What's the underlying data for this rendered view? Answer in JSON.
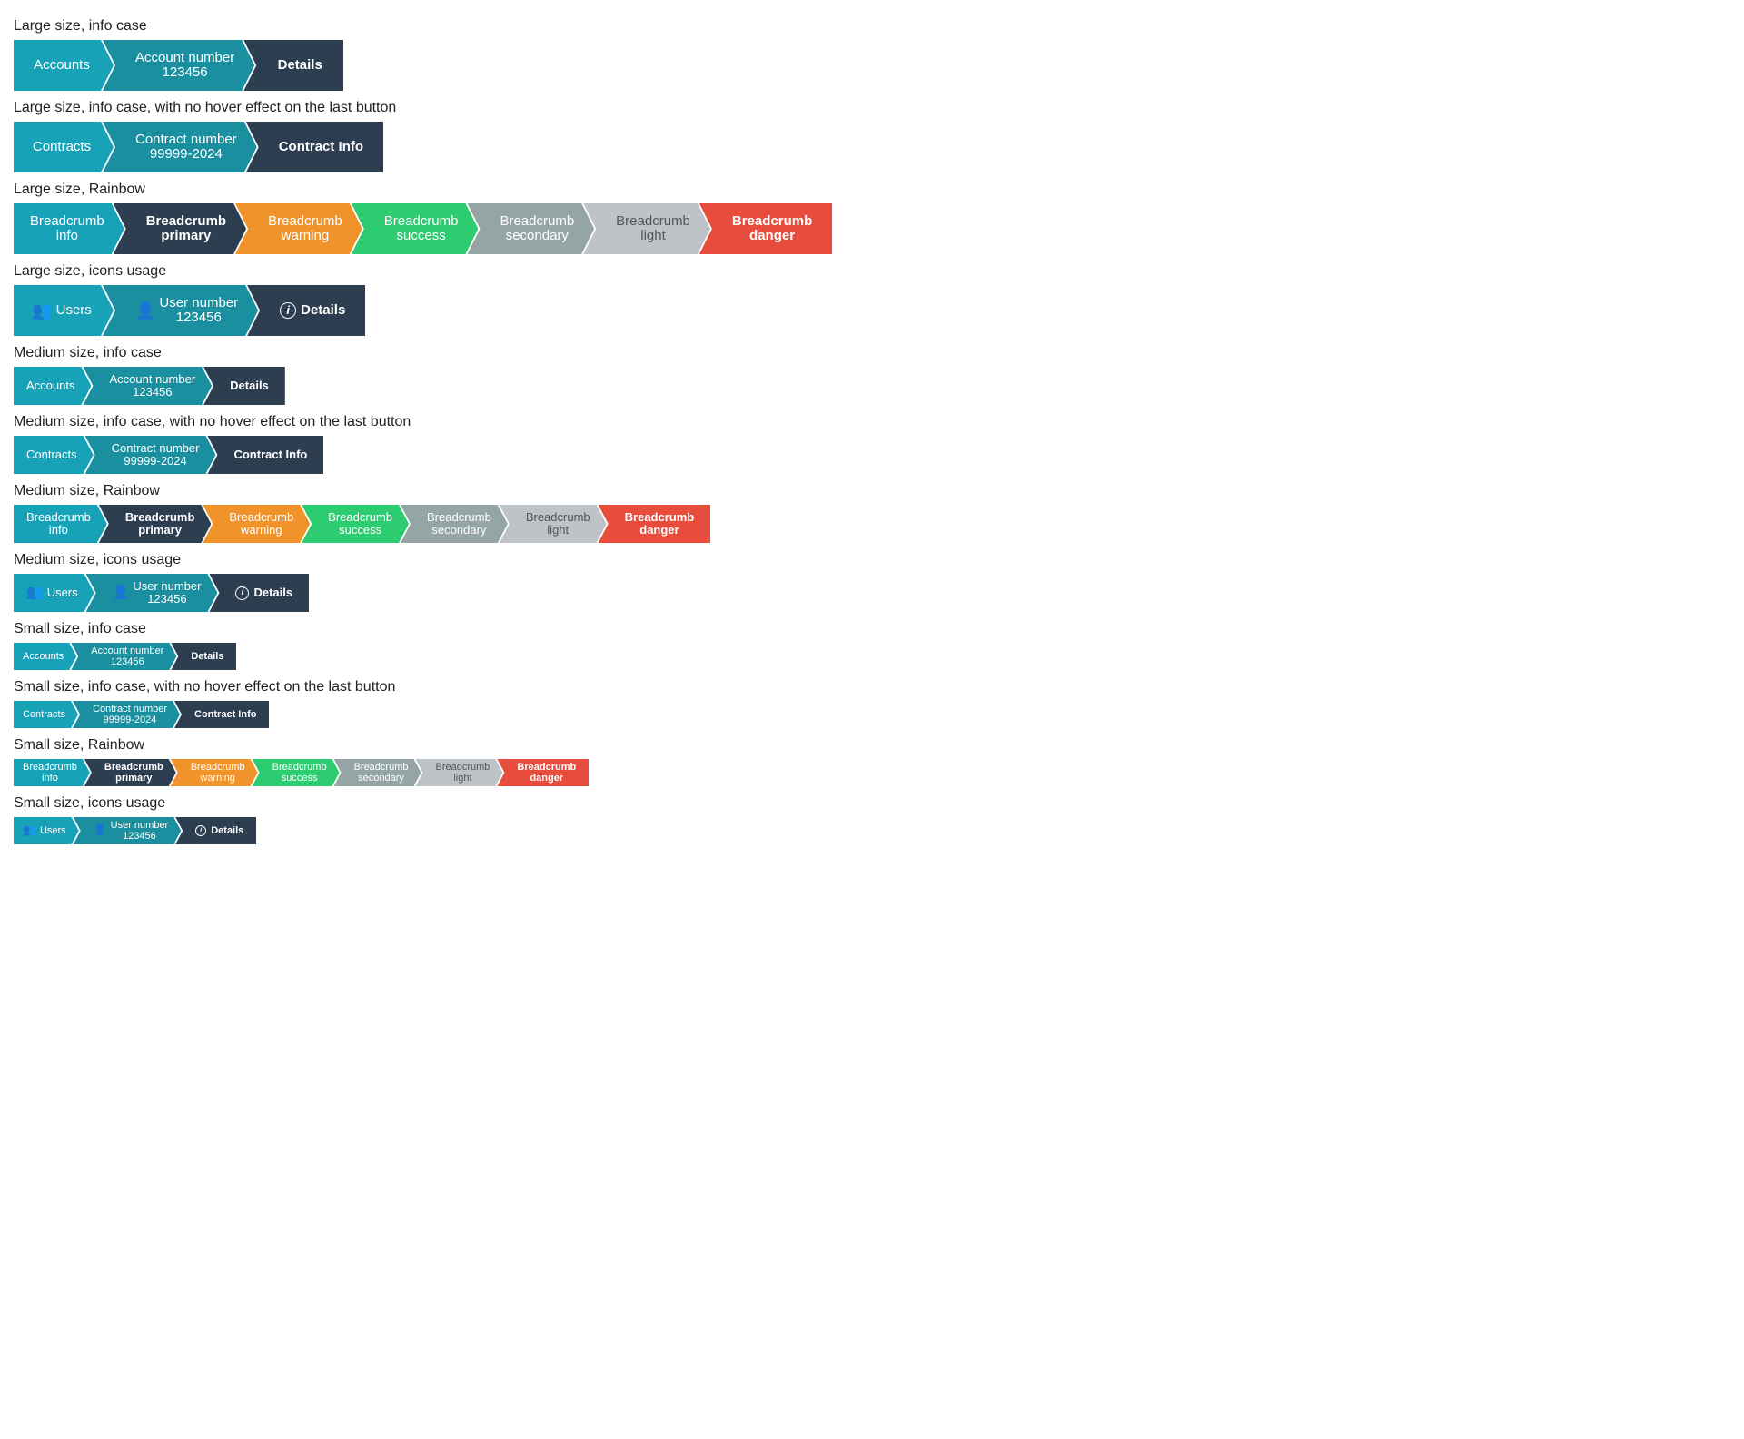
{
  "sections": [
    {
      "id": "large-info",
      "label": "Large size, info case",
      "trails": [
        {
          "id": "trail-large-info-1",
          "size": "lg",
          "crumbs": [
            {
              "id": "c1",
              "text": "Accounts",
              "color": "info",
              "position": "first",
              "bold": false,
              "icon": null
            },
            {
              "id": "c2",
              "text1": "Account number",
              "text2": "123456",
              "color": "teal",
              "position": "middle",
              "bold": false,
              "icon": null
            },
            {
              "id": "c3",
              "text": "Details",
              "color": "primary",
              "position": "last",
              "bold": true,
              "icon": null
            }
          ]
        }
      ]
    },
    {
      "id": "large-info-no-hover",
      "label": "Large size, info case, with no hover effect on the last button",
      "trails": [
        {
          "id": "trail-large-info-2",
          "size": "lg",
          "crumbs": [
            {
              "id": "c1",
              "text": "Contracts",
              "color": "info",
              "position": "first",
              "bold": false,
              "icon": null
            },
            {
              "id": "c2",
              "text1": "Contract number",
              "text2": "99999-2024",
              "color": "teal",
              "position": "middle",
              "bold": false,
              "icon": null
            },
            {
              "id": "c3",
              "text": "Contract Info",
              "color": "primary",
              "position": "last",
              "bold": true,
              "icon": null
            }
          ]
        }
      ]
    },
    {
      "id": "large-rainbow",
      "label": "Large size, Rainbow",
      "trails": [
        {
          "id": "trail-large-rainbow",
          "size": "lg",
          "crumbs": [
            {
              "id": "c1",
              "text1": "Breadcrumb",
              "text2": "info",
              "color": "info",
              "position": "first",
              "bold": false,
              "icon": null
            },
            {
              "id": "c2",
              "text1": "Breadcrumb",
              "text2": "primary",
              "color": "primary",
              "position": "middle",
              "bold": true,
              "icon": null
            },
            {
              "id": "c3",
              "text1": "Breadcrumb",
              "text2": "warning",
              "color": "warning",
              "position": "middle",
              "bold": false,
              "icon": null
            },
            {
              "id": "c4",
              "text1": "Breadcrumb",
              "text2": "success",
              "color": "success",
              "position": "middle",
              "bold": false,
              "icon": null
            },
            {
              "id": "c5",
              "text1": "Breadcrumb",
              "text2": "secondary",
              "color": "secondary",
              "position": "middle",
              "bold": false,
              "icon": null
            },
            {
              "id": "c6",
              "text1": "Breadcrumb",
              "text2": "light",
              "color": "light",
              "position": "middle",
              "bold": false,
              "icon": null
            },
            {
              "id": "c7",
              "text1": "Breadcrumb",
              "text2": "danger",
              "color": "danger",
              "position": "last",
              "bold": true,
              "icon": null
            }
          ]
        }
      ]
    },
    {
      "id": "large-icons",
      "label": "Large size, icons usage",
      "trails": [
        {
          "id": "trail-large-icons",
          "size": "lg",
          "crumbs": [
            {
              "id": "c1",
              "text": "Users",
              "color": "info",
              "position": "first",
              "bold": false,
              "icon": "users"
            },
            {
              "id": "c2",
              "text1": "User number",
              "text2": "123456",
              "color": "teal",
              "position": "middle",
              "bold": false,
              "icon": "user"
            },
            {
              "id": "c3",
              "text": "Details",
              "color": "primary",
              "position": "last",
              "bold": true,
              "icon": "info-circle"
            }
          ]
        }
      ]
    },
    {
      "id": "medium-info",
      "label": "Medium size, info case",
      "trails": [
        {
          "id": "trail-medium-info-1",
          "size": "md",
          "crumbs": [
            {
              "id": "c1",
              "text": "Accounts",
              "color": "info",
              "position": "first",
              "bold": false,
              "icon": null
            },
            {
              "id": "c2",
              "text1": "Account number",
              "text2": "123456",
              "color": "teal",
              "position": "middle",
              "bold": false,
              "icon": null
            },
            {
              "id": "c3",
              "text": "Details",
              "color": "primary",
              "position": "last",
              "bold": true,
              "icon": null
            }
          ]
        }
      ]
    },
    {
      "id": "medium-info-no-hover",
      "label": "Medium size, info case, with no hover effect on the last button",
      "trails": [
        {
          "id": "trail-medium-info-2",
          "size": "md",
          "crumbs": [
            {
              "id": "c1",
              "text": "Contracts",
              "color": "info",
              "position": "first",
              "bold": false,
              "icon": null
            },
            {
              "id": "c2",
              "text1": "Contract number",
              "text2": "99999-2024",
              "color": "teal",
              "position": "middle",
              "bold": false,
              "icon": null
            },
            {
              "id": "c3",
              "text": "Contract Info",
              "color": "primary",
              "position": "last",
              "bold": true,
              "icon": null
            }
          ]
        }
      ]
    },
    {
      "id": "medium-rainbow",
      "label": "Medium size, Rainbow",
      "trails": [
        {
          "id": "trail-medium-rainbow",
          "size": "md",
          "crumbs": [
            {
              "id": "c1",
              "text1": "Breadcrumb",
              "text2": "info",
              "color": "info",
              "position": "first",
              "bold": false,
              "icon": null
            },
            {
              "id": "c2",
              "text1": "Breadcrumb",
              "text2": "primary",
              "color": "primary",
              "position": "middle",
              "bold": true,
              "icon": null
            },
            {
              "id": "c3",
              "text1": "Breadcrumb",
              "text2": "warning",
              "color": "warning",
              "position": "middle",
              "bold": false,
              "icon": null
            },
            {
              "id": "c4",
              "text1": "Breadcrumb",
              "text2": "success",
              "color": "success",
              "position": "middle",
              "bold": false,
              "icon": null
            },
            {
              "id": "c5",
              "text1": "Breadcrumb",
              "text2": "secondary",
              "color": "secondary",
              "position": "middle",
              "bold": false,
              "icon": null
            },
            {
              "id": "c6",
              "text1": "Breadcrumb",
              "text2": "light",
              "color": "light",
              "position": "middle",
              "bold": false,
              "icon": null
            },
            {
              "id": "c7",
              "text1": "Breadcrumb",
              "text2": "danger",
              "color": "danger",
              "position": "last",
              "bold": true,
              "icon": null
            }
          ]
        }
      ]
    },
    {
      "id": "medium-icons",
      "label": "Medium size, icons usage",
      "trails": [
        {
          "id": "trail-medium-icons",
          "size": "md",
          "crumbs": [
            {
              "id": "c1",
              "text": "Users",
              "color": "info",
              "position": "first",
              "bold": false,
              "icon": "users"
            },
            {
              "id": "c2",
              "text1": "User number",
              "text2": "123456",
              "color": "teal",
              "position": "middle",
              "bold": false,
              "icon": "user"
            },
            {
              "id": "c3",
              "text": "Details",
              "color": "primary",
              "position": "last",
              "bold": true,
              "icon": "info-circle"
            }
          ]
        }
      ]
    },
    {
      "id": "small-info",
      "label": "Small size, info case",
      "trails": [
        {
          "id": "trail-small-info-1",
          "size": "sm",
          "crumbs": [
            {
              "id": "c1",
              "text": "Accounts",
              "color": "info",
              "position": "first",
              "bold": false,
              "icon": null
            },
            {
              "id": "c2",
              "text1": "Account number",
              "text2": "123456",
              "color": "teal",
              "position": "middle",
              "bold": false,
              "icon": null
            },
            {
              "id": "c3",
              "text": "Details",
              "color": "primary",
              "position": "last",
              "bold": true,
              "icon": null
            }
          ]
        }
      ]
    },
    {
      "id": "small-info-no-hover",
      "label": "Small size, info case, with no hover effect on the last button",
      "trails": [
        {
          "id": "trail-small-info-2",
          "size": "sm",
          "crumbs": [
            {
              "id": "c1",
              "text": "Contracts",
              "color": "info",
              "position": "first",
              "bold": false,
              "icon": null
            },
            {
              "id": "c2",
              "text1": "Contract number",
              "text2": "99999-2024",
              "color": "teal",
              "position": "middle",
              "bold": false,
              "icon": null
            },
            {
              "id": "c3",
              "text": "Contract Info",
              "color": "primary",
              "position": "last",
              "bold": true,
              "icon": null
            }
          ]
        }
      ]
    },
    {
      "id": "small-rainbow",
      "label": "Small size, Rainbow",
      "trails": [
        {
          "id": "trail-small-rainbow",
          "size": "sm",
          "crumbs": [
            {
              "id": "c1",
              "text1": "Breadcrumb",
              "text2": "info",
              "color": "info",
              "position": "first",
              "bold": false,
              "icon": null
            },
            {
              "id": "c2",
              "text1": "Breadcrumb",
              "text2": "primary",
              "color": "primary",
              "position": "middle",
              "bold": true,
              "icon": null
            },
            {
              "id": "c3",
              "text1": "Breadcrumb",
              "text2": "warning",
              "color": "warning",
              "position": "middle",
              "bold": false,
              "icon": null
            },
            {
              "id": "c4",
              "text1": "Breadcrumb",
              "text2": "success",
              "color": "success",
              "position": "middle",
              "bold": false,
              "icon": null
            },
            {
              "id": "c5",
              "text1": "Breadcrumb",
              "text2": "secondary",
              "color": "secondary",
              "position": "middle",
              "bold": false,
              "icon": null
            },
            {
              "id": "c6",
              "text1": "Breadcrumb",
              "text2": "light",
              "color": "light",
              "position": "middle",
              "bold": false,
              "icon": null
            },
            {
              "id": "c7",
              "text1": "Breadcrumb",
              "text2": "danger",
              "color": "danger",
              "position": "last",
              "bold": true,
              "icon": null
            }
          ]
        }
      ]
    },
    {
      "id": "small-icons",
      "label": "Small size, icons usage",
      "trails": [
        {
          "id": "trail-small-icons",
          "size": "sm",
          "crumbs": [
            {
              "id": "c1",
              "text": "Users",
              "color": "info",
              "position": "first",
              "bold": false,
              "icon": "users"
            },
            {
              "id": "c2",
              "text1": "User number",
              "text2": "123456",
              "color": "teal",
              "position": "middle",
              "bold": false,
              "icon": "user"
            },
            {
              "id": "c3",
              "text": "Details",
              "color": "primary",
              "position": "last",
              "bold": true,
              "icon": "info-circle"
            }
          ]
        }
      ]
    }
  ],
  "colors": {
    "info": "#17a2b8",
    "teal": "#1a8fa0",
    "primary": "#2c3e50",
    "warning": "#f0932b",
    "success": "#2ecc71",
    "secondary": "#95a5a6",
    "light": "#bdc3c7",
    "danger": "#e74c3c"
  }
}
